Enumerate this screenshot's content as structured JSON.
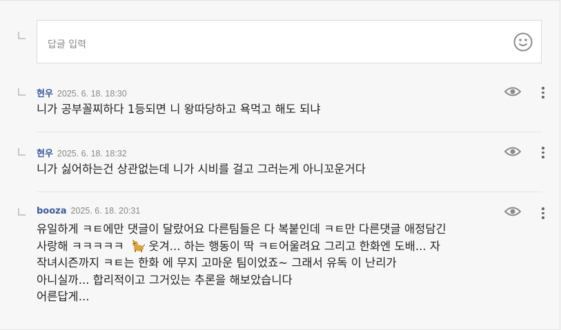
{
  "reply_input": {
    "placeholder": "답글 입력"
  },
  "comments": [
    {
      "author": "현우",
      "date": "2025. 6. 18. 18:30",
      "text": "니가 공부꼴찌하다 1등되면 니 왕따당하고 욕먹고 해도 되냐"
    },
    {
      "author": "현우",
      "date": "2025. 6. 18. 18:32",
      "text": "니가 싫어하는건 상관없는데 니가 시비를 걸고 그러는게 아니꼬운거다"
    },
    {
      "author": "booza",
      "date": "2025. 6. 18. 20:31",
      "text_line1": "유일하게 ㅋㅌ에만 댓글이 달랐어요 다른팀들은 다 복붙인데 ㅋㅌ만 다른댓글 애정담긴",
      "text_line2a": "사랑해 ㅋㅋㅋㅋㅋ",
      "text_line2b": " 웃겨... 하는 행동이 딱 ㅋㅌ어울려요 그리고 한화엔 도배... 자",
      "text_line3": "작녀시즌까지 ㅋㅌ는 한화 에 무지 고마운 팀이었죠~  그래서 유독 이 난리가",
      "text_line4": "아니실까... 합리적이고 그거있는 추론을 해보았습니다",
      "text_line5": "어른답게..."
    }
  ],
  "icons": {
    "emoji": "smiley-icon",
    "view": "eye-icon",
    "menu": "more-vertical-icon",
    "inline": "dog-emoji-icon"
  }
}
